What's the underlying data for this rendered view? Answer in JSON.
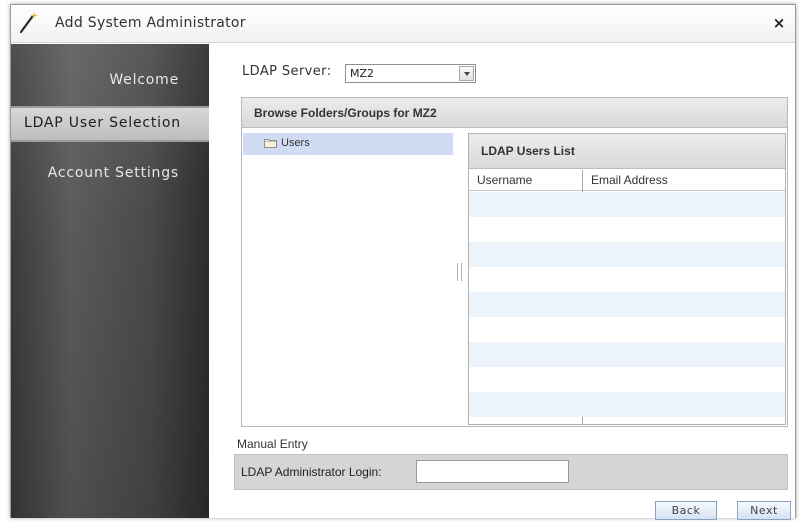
{
  "window": {
    "title": "Add System Administrator",
    "close_label": "×"
  },
  "sidebar": {
    "items": [
      {
        "label": "Welcome",
        "selected": false
      },
      {
        "label": "LDAP User Selection",
        "selected": true
      },
      {
        "label": "Account Settings",
        "selected": false
      }
    ]
  },
  "server": {
    "label": "LDAP Server:",
    "selected": "MZ2"
  },
  "browse": {
    "title": "Browse Folders/Groups for MZ2",
    "tree": [
      {
        "label": "Users",
        "selected": true
      }
    ]
  },
  "users_list": {
    "title": "LDAP Users List",
    "columns": [
      "Username",
      "Email Address"
    ],
    "rows": []
  },
  "manual_entry": {
    "label": "Manual Entry",
    "login_label": "LDAP Administrator Login:",
    "login_value": ""
  },
  "buttons": {
    "back": "Back",
    "next": "Next"
  },
  "colors": {
    "sidebar_bg": "#4a4a4a",
    "selected_nav": "#c9c9c9",
    "tree_selection": "#cfdcf2",
    "row_alt": "#edf3fb",
    "button_border": "#8aa3c4"
  }
}
